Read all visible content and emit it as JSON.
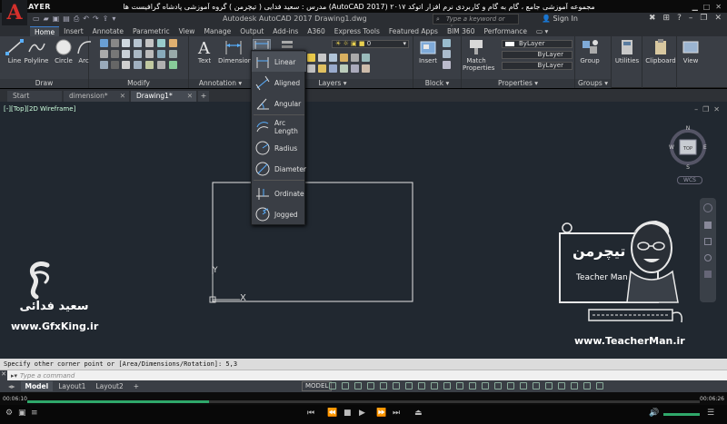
{
  "player": {
    "brand": "KMPLAYER",
    "title": "مجموعه آموزشی جامع ، گام به گام و کاربردی نرم افزار  اتوکد ۲۰۱۷ (AutoCAD 2017)   مدرس : سعید فدایی ( تیچرمن ) گروه آموزشی پادشاه گرافیست ها",
    "time_elapsed": "00:06:10",
    "time_total": "00:06:26",
    "progress": 0.27
  },
  "app": {
    "logo": "A",
    "doc_title": "Autodesk AutoCAD 2017    Drawing1.dwg",
    "search_placeholder": "Type a keyword or phrase",
    "sign_in": "Sign In"
  },
  "ribbon_tabs": [
    "Home",
    "Insert",
    "Annotate",
    "Parametric",
    "View",
    "Manage",
    "Output",
    "Add-ins",
    "A360",
    "Express Tools",
    "Featured Apps",
    "BIM 360",
    "Performance"
  ],
  "active_tab": "Home",
  "ribbon": {
    "draw": {
      "label": "Draw",
      "tools": [
        "Line",
        "Polyline",
        "Circle",
        "Arc"
      ]
    },
    "modify": {
      "label": "Modify"
    },
    "annotation": {
      "label": "Annotation",
      "tools": [
        "Text",
        "Dimension"
      ]
    },
    "layers": {
      "label": "Layers",
      "current_layer": "0"
    },
    "block": {
      "label": "Block",
      "tools": [
        "Insert"
      ]
    },
    "properties": {
      "label": "Properties",
      "match": "Match\nProperties",
      "bylayer_1": "ByLayer",
      "bylayer_2": "ByLayer",
      "bylayer_3": "ByLayer"
    },
    "groups": {
      "label": "Groups",
      "tool": "Group"
    },
    "utilities": "Utilities",
    "clipboard": "Clipboard",
    "view": "View"
  },
  "file_tabs": [
    {
      "label": "Start"
    },
    {
      "label": "dimension*"
    },
    {
      "label": "Drawing1*"
    }
  ],
  "viewport_label": "[-][Top][2D Wireframe]",
  "dimension_menu": [
    "Linear",
    "Aligned",
    "Angular",
    "Arc Length",
    "Radius",
    "Diameter",
    "Ordinate",
    "Jogged"
  ],
  "viewcube": {
    "top": "TOP",
    "n": "N",
    "s": "S",
    "e": "E",
    "w": "W",
    "wcs": "WCS"
  },
  "ucs": {
    "x": "X",
    "y": "Y"
  },
  "watermarks": {
    "left_name": "سعید فدائی",
    "left_site": "www.GfxKing.ir",
    "right_brand": "تیچرمن",
    "right_sub": "Teacher Man",
    "right_site": "www.TeacherMan.ir"
  },
  "command": {
    "history": "Specify other corner point or [Area/Dimensions/Rotation]: 5,3",
    "placeholder": "Type a command"
  },
  "layout_tabs": [
    "Model",
    "Layout1",
    "Layout2"
  ],
  "status": {
    "model": "MODEL"
  },
  "colors": {
    "canvas": "#212830",
    "ribbon": "#3a3e45",
    "accent": "#3c7fd0",
    "acad_red": "#d4302c",
    "progress": "#2fa86a"
  }
}
